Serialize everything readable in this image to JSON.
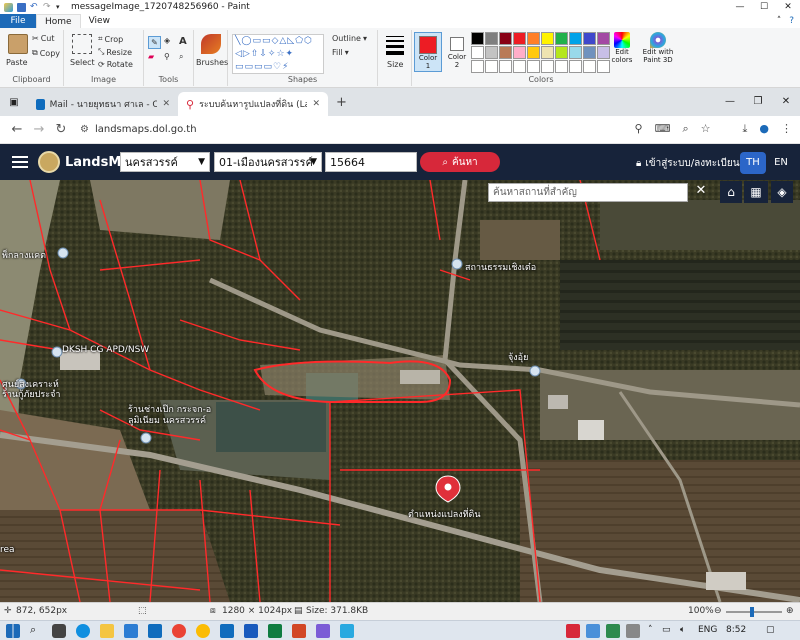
{
  "paint": {
    "title": "messageImage_1720748256960 - Paint",
    "tabs": {
      "file": "File",
      "home": "Home",
      "view": "View"
    },
    "groups": {
      "clipboard": "Clipboard",
      "image": "Image",
      "tools": "Tools",
      "shapes": "Shapes",
      "colors": "Colors"
    },
    "buttons": {
      "paste": "Paste",
      "cut": "Cut",
      "copy": "Copy",
      "select": "Select",
      "crop": "Crop",
      "resize": "Resize",
      "rotate": "Rotate",
      "brushes": "Brushes",
      "outline": "Outline",
      "fill": "Fill",
      "size": "Size",
      "color1": "Color\n1",
      "color2": "Color\n2",
      "edit_colors": "Edit\ncolors",
      "edit_3d": "Edit with\nPaint 3D"
    },
    "palette": [
      "#000000",
      "#7f7f7f",
      "#880015",
      "#ed1c24",
      "#ff7f27",
      "#fff200",
      "#22b14c",
      "#00a2e8",
      "#3f48cc",
      "#a349a4",
      "#ffffff",
      "#c3c3c3",
      "#b97a57",
      "#ffaec9",
      "#ffc90e",
      "#efe4b0",
      "#b5e61d",
      "#99d9ea",
      "#7092be",
      "#c8bfe7",
      "#ffffff",
      "#ffffff",
      "#ffffff",
      "#ffffff",
      "#ffffff",
      "#ffffff",
      "#ffffff",
      "#ffffff",
      "#ffffff",
      "#ffffff"
    ],
    "color1": "#ed1c24",
    "status": {
      "cursor": "872, 652px",
      "dimensions": "1280 × 1024px",
      "size": "Size: 371.8KB",
      "zoom": "100%"
    }
  },
  "browser": {
    "tabs": [
      {
        "label": "Mail - นายยุทธนา ศาเล - Outlook"
      },
      {
        "label": "ระบบค้นหารูปแปลงที่ดิน (LandsMap",
        "active": true
      }
    ],
    "url": "landsmaps.dol.go.th"
  },
  "landsmaps": {
    "brand": "LandsMaps",
    "province": "นครสวรรค์",
    "district": "01-เมืองนครสวรรค์",
    "parcel_number": "15664",
    "search_label": "ค้นหา",
    "login_label": "เข้าสู่ระบบ/ลงทะเบียน",
    "lang_th": "TH",
    "lang_en": "EN",
    "place_search_placeholder": "ค้นหาสถานที่สำคัญ",
    "map_labels": {
      "poi1": "พ็กลางแคต",
      "temple": "สถานธรรมเชิงเต๋อ",
      "dksh": "DKSH CG APD/NSW",
      "center": "ศูนย์สงเคราะห์\nร้านกู้ภัยประจำ",
      "shop": "ร้านช่างเป๊ก กระจก-อ\nลูมิเนียม นครสวรรค์",
      "jungui": "จุ้งอุ้ย",
      "parcel": "ตำแหน่งแปลงที่ดิน",
      "area": "rea"
    }
  },
  "taskbar": {
    "lang": "ENG",
    "time": "8:52"
  }
}
